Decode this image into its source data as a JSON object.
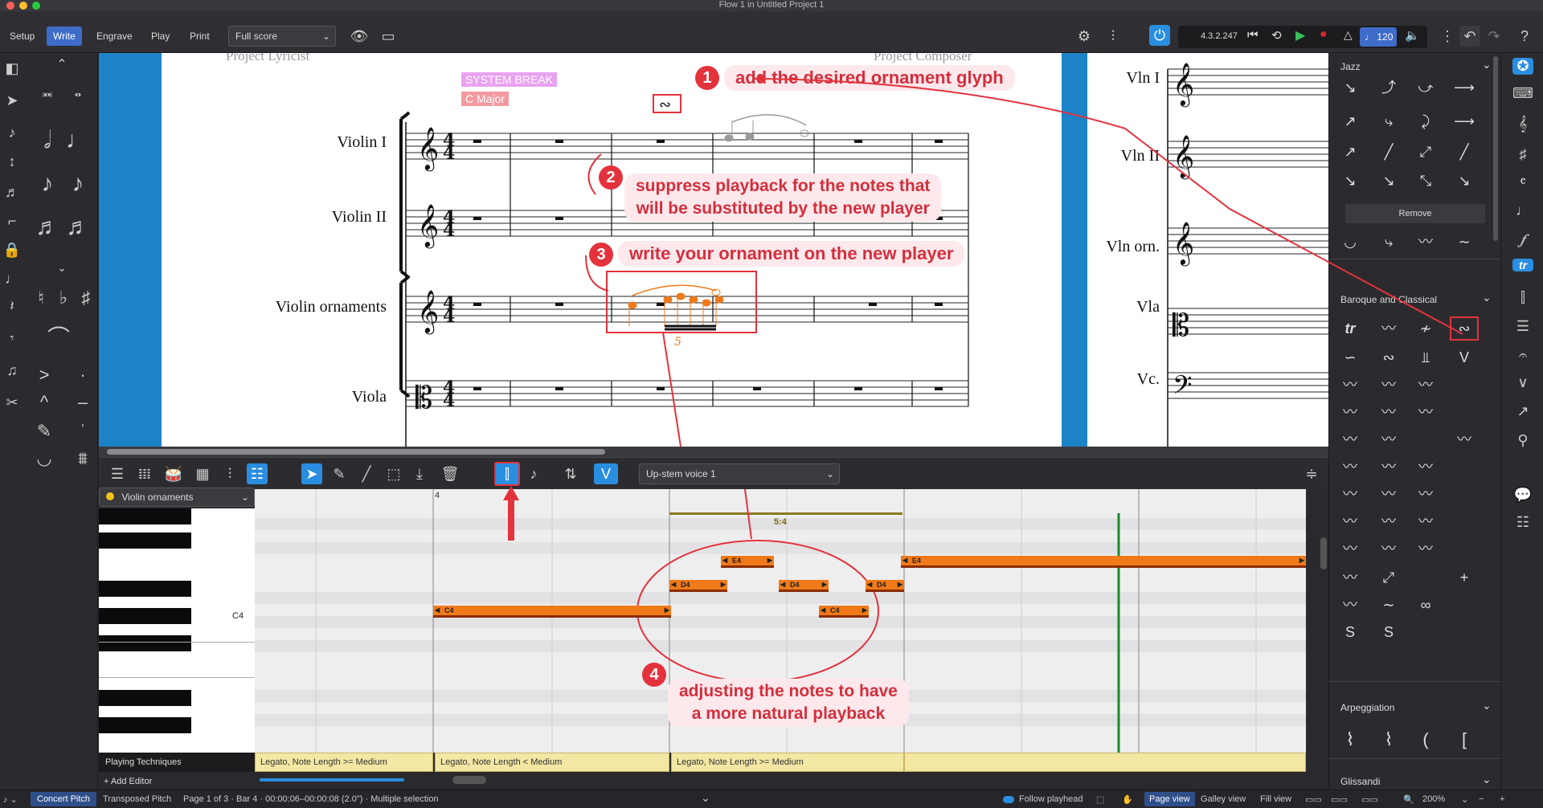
{
  "titlebar": {
    "title": "Flow 1 in Untitled Project 1"
  },
  "toolbar": {
    "modes": [
      "Setup",
      "Write",
      "Engrave",
      "Play",
      "Print"
    ],
    "active_mode": "Write",
    "layout_select": "Full score",
    "version": "4.3.2.247",
    "tempo": "120",
    "icons": [
      "eye-icon",
      "window-icon",
      "mixer-icon",
      "settings-sliders-icon",
      "power-icon",
      "rewind-icon",
      "play-icon",
      "record-icon",
      "metronome-icon",
      "note-tempo-icon",
      "speaker-icon",
      "more-icon",
      "undo-icon",
      "redo-icon",
      "help-icon"
    ]
  },
  "score": {
    "page1": {
      "header_left": "Project Lyricist",
      "header_right": "Project Composer",
      "system_break": "SYSTEM BREAK",
      "key_signature": "C Major",
      "instruments": [
        "Violin I",
        "Violin II",
        "Violin ornaments",
        "Viola"
      ]
    },
    "page2": {
      "instruments": [
        "Vln I",
        "Vln II",
        "Vln orn.",
        "Vla",
        "Vc."
      ]
    },
    "tuplet": "5",
    "annotations": [
      {
        "n": "1",
        "text": "add the desired ornament glyph"
      },
      {
        "n": "2",
        "text": "suppress playback for the notes that will be substituted by the new player"
      },
      {
        "n": "3",
        "text": "write your ornament on the new player"
      },
      {
        "n": "4",
        "text": "adjusting the notes to have a more natural playback"
      }
    ],
    "annotation2_lines": [
      "suppress playback for the notes that",
      "will be substituted by the new player"
    ],
    "annotation4_lines": [
      "adjusting the notes to have",
      "a more natural playback"
    ]
  },
  "roll": {
    "voice_select": "Up-stem voice 1",
    "track_select": "Violin ornaments",
    "bar_number": "4",
    "tuplet_label": "5:4",
    "c4_label": "C4",
    "notes": [
      {
        "label": "C4"
      },
      {
        "label": "D4"
      },
      {
        "label": "E4"
      },
      {
        "label": "D4"
      },
      {
        "label": "C4"
      },
      {
        "label": "D4"
      },
      {
        "label": "E4"
      }
    ],
    "playing_techniques_label": "Playing Techniques",
    "add_editor": "+ Add Editor",
    "techniques": [
      "Legato, Note Length >= Medium",
      "Legato, Note Length < Medium",
      "Legato, Note Length >= Medium"
    ]
  },
  "rightpanel": {
    "sections": [
      "Jazz",
      "Baroque and Classical",
      "Arpeggiation",
      "Glissandi"
    ],
    "remove_label": "Remove"
  },
  "statusbar": {
    "concert_pitch": "Concert Pitch",
    "transposed_pitch": "Transposed Pitch",
    "info": "Page 1 of 3 · Bar 4 · 00:00:06–00:00:08 (2.0\") · Multiple selection",
    "follow_playhead": "Follow playhead",
    "page_view": "Page view",
    "galley_view": "Galley view",
    "fill_view": "Fill view",
    "zoom": "200%"
  },
  "colors": {
    "accent": "#3e6cc8",
    "annotation": "#e3323c",
    "note": "#f07a1a",
    "playhead": "#1e8a2a"
  }
}
